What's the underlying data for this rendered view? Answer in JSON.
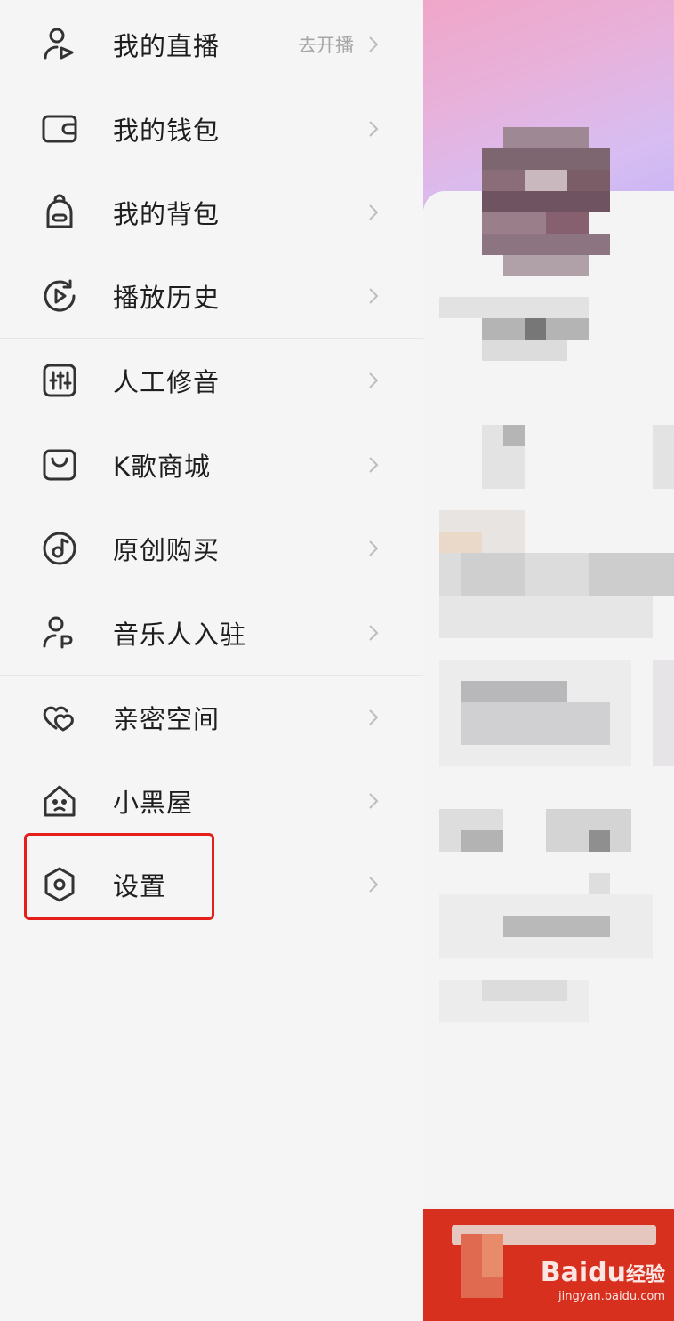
{
  "menu": {
    "items": [
      {
        "label": "我的直播",
        "sub": "去开播",
        "icon": "user-live-icon"
      },
      {
        "label": "我的钱包",
        "icon": "wallet-icon"
      },
      {
        "label": "我的背包",
        "icon": "backpack-icon"
      },
      {
        "label": "播放历史",
        "icon": "history-icon"
      },
      {
        "label": "人工修音",
        "icon": "equalizer-icon"
      },
      {
        "label": "K歌商城",
        "icon": "shopping-bag-icon"
      },
      {
        "label": "原创购买",
        "icon": "music-disc-icon"
      },
      {
        "label": "音乐人入驻",
        "icon": "musician-icon"
      },
      {
        "label": "亲密空间",
        "icon": "hearts-icon"
      },
      {
        "label": "小黑屋",
        "icon": "dark-room-icon"
      },
      {
        "label": "设置",
        "icon": "settings-hex-icon",
        "highlighted": true
      }
    ]
  },
  "watermark": {
    "brand": "Bai",
    "brand_mid": "du",
    "brand_cn": "经验",
    "url": "jingyan.baidu.com"
  },
  "colors": {
    "accent_red": "#d8301f",
    "highlight_border": "#e5201c"
  }
}
